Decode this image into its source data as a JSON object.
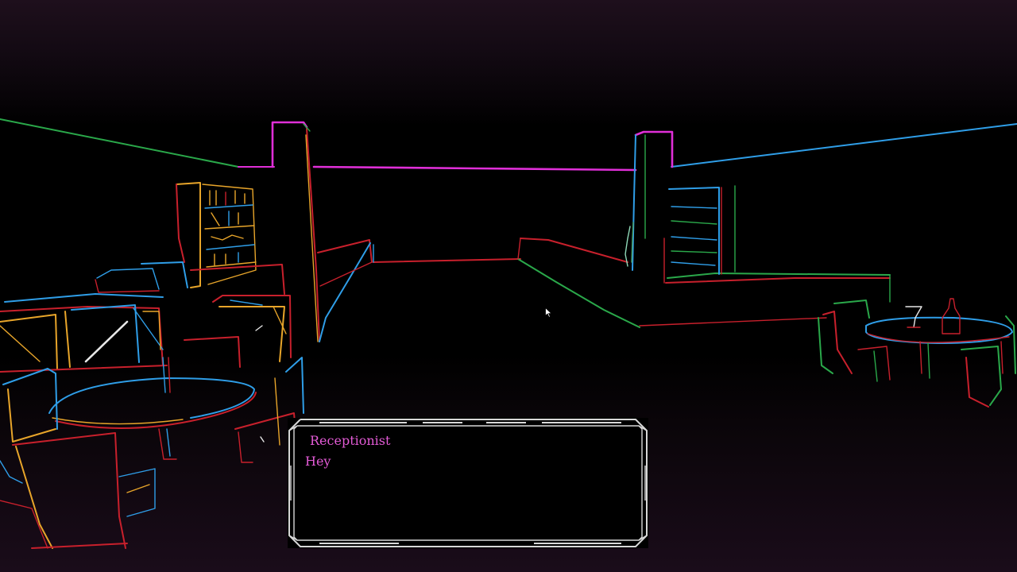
{
  "dialogue": {
    "speaker": "Receptionist",
    "text": "Hey"
  },
  "palette": {
    "magenta": "#e02fd8",
    "red": "#c8202c",
    "orange": "#e8a52a",
    "blue": "#2f9ee8",
    "green": "#2aa84a",
    "dialogue_text": "#e35bd6",
    "frame": "#d8d8d8"
  },
  "icons": {
    "cursor": "mouse-pointer-icon"
  }
}
